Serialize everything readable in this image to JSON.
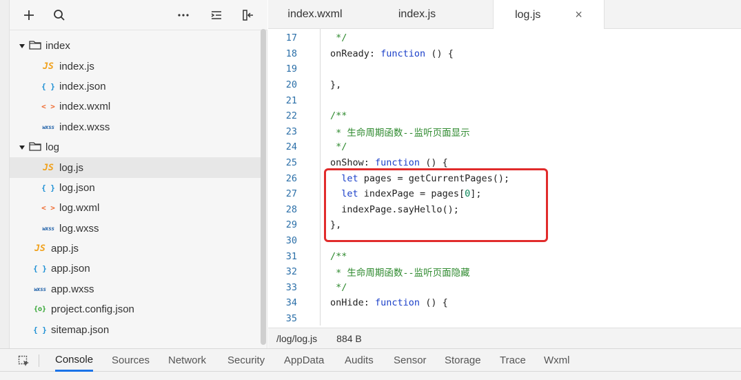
{
  "explorer": {
    "toolbar": {
      "add_icon": "plus-icon",
      "search_icon": "search-icon",
      "more_icon": "more-icon",
      "collapse_icon": "collapse-icon",
      "layout_icon": "layout-icon"
    },
    "tree": [
      {
        "label": "index",
        "type": "folder",
        "level": 0,
        "expanded": true
      },
      {
        "label": "index.js",
        "type": "js",
        "icon": "JS",
        "level": 1
      },
      {
        "label": "index.json",
        "type": "json",
        "icon": "{ }",
        "level": 1
      },
      {
        "label": "index.wxml",
        "type": "wxml",
        "icon": "< >",
        "level": 1
      },
      {
        "label": "index.wxss",
        "type": "wxss",
        "icon": "wxss",
        "level": 1
      },
      {
        "label": "log",
        "type": "folder",
        "level": 0,
        "expanded": true
      },
      {
        "label": "log.js",
        "type": "js",
        "icon": "JS",
        "level": 1,
        "selected": true
      },
      {
        "label": "log.json",
        "type": "json",
        "icon": "{ }",
        "level": 1
      },
      {
        "label": "log.wxml",
        "type": "wxml",
        "icon": "< >",
        "level": 1
      },
      {
        "label": "log.wxss",
        "type": "wxss",
        "icon": "wxss",
        "level": 1
      },
      {
        "label": "app.js",
        "type": "js",
        "icon": "JS",
        "level": 0
      },
      {
        "label": "app.json",
        "type": "json",
        "icon": "{ }",
        "level": 0
      },
      {
        "label": "app.wxss",
        "type": "wxss",
        "icon": "wxss",
        "level": 0
      },
      {
        "label": "project.config.json",
        "type": "config",
        "icon": "{o}",
        "level": 0
      },
      {
        "label": "sitemap.json",
        "type": "json",
        "icon": "{ }",
        "level": 0
      }
    ]
  },
  "tabs": [
    {
      "label": "index.wxml",
      "active": false
    },
    {
      "label": "index.js",
      "active": false
    },
    {
      "label": "log.js",
      "active": true,
      "close": "×"
    }
  ],
  "editor": {
    "lines": [
      {
        "n": "17",
        "html": "<span class=\"cm\"> */</span>"
      },
      {
        "n": "18",
        "html": "onReady: <span class=\"kw\">function</span> () {"
      },
      {
        "n": "19",
        "html": ""
      },
      {
        "n": "20",
        "html": "},"
      },
      {
        "n": "21",
        "html": ""
      },
      {
        "n": "22",
        "html": "<span class=\"cm\">/**</span>"
      },
      {
        "n": "23",
        "html": "<span class=\"cm\"> * 生命周期函数--监听页面显示</span>"
      },
      {
        "n": "24",
        "html": "<span class=\"cm\"> */</span>"
      },
      {
        "n": "25",
        "html": "onShow: <span class=\"kw\">function</span> () {"
      },
      {
        "n": "26",
        "html": "  <span class=\"kw\">let</span> pages = getCurrentPages();"
      },
      {
        "n": "27",
        "html": "  <span class=\"kw\">let</span> indexPage = pages[<span class=\"num\">0</span>];"
      },
      {
        "n": "28",
        "html": "  indexPage.sayHello();"
      },
      {
        "n": "29",
        "html": "},"
      },
      {
        "n": "30",
        "html": ""
      },
      {
        "n": "31",
        "html": "<span class=\"cm\">/**</span>"
      },
      {
        "n": "32",
        "html": "<span class=\"cm\"> * 生命周期函数--监听页面隐藏</span>"
      },
      {
        "n": "33",
        "html": "<span class=\"cm\"> */</span>"
      },
      {
        "n": "34",
        "html": "onHide: <span class=\"kw\">function</span> () {"
      },
      {
        "n": "35",
        "html": ""
      }
    ],
    "highlight_color": "#e12b2b"
  },
  "status": {
    "path": "/log/log.js",
    "size": "884 B"
  },
  "devtools": {
    "tabs": [
      "Console",
      "Sources",
      "Network",
      "Security",
      "AppData",
      "Audits",
      "Sensor",
      "Storage",
      "Trace",
      "Wxml"
    ],
    "active": "Console"
  }
}
